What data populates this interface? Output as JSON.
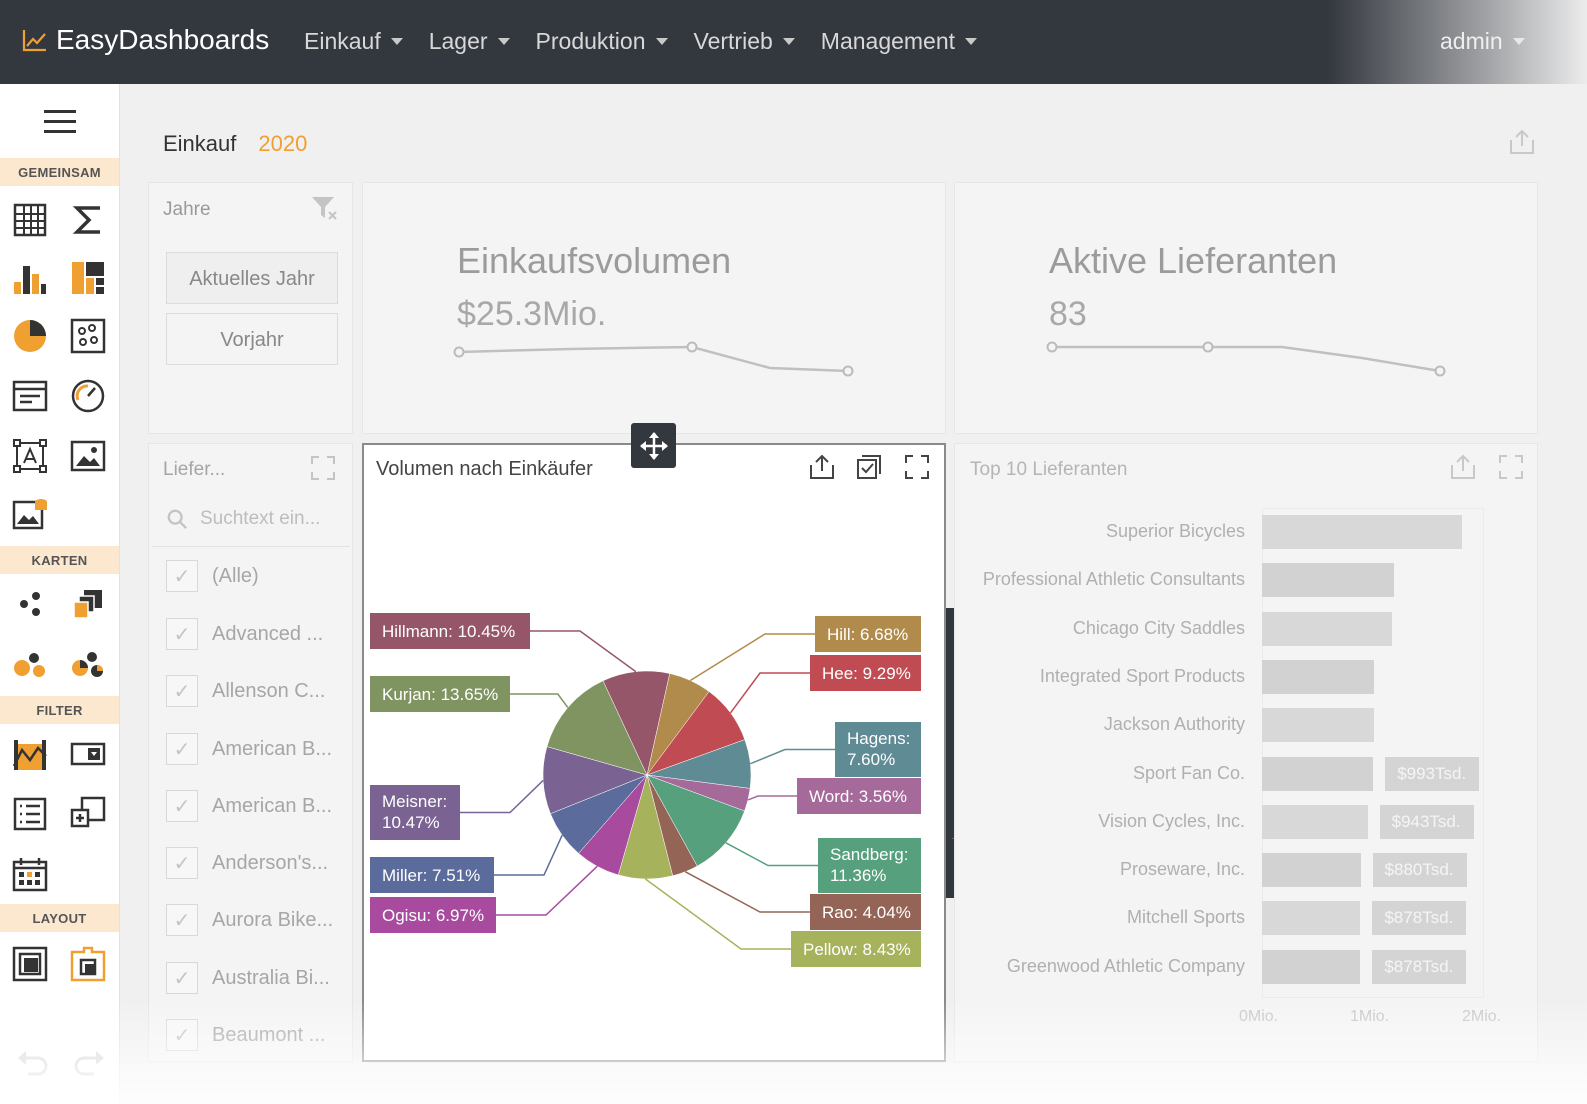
{
  "app": {
    "brand": "EasyDashboards",
    "user": "admin"
  },
  "nav": [
    "Einkauf",
    "Lager",
    "Produktion",
    "Vertrieb",
    "Management"
  ],
  "sidebar": {
    "sections": [
      "GEMEINSAM",
      "KARTEN",
      "FILTER",
      "LAYOUT"
    ],
    "icons": [
      "grid-icon",
      "sigma-icon",
      "bar-chart-icon",
      "treemap-icon",
      "pie-icon",
      "scatter-icon",
      "cards-icon",
      "gauge-icon",
      "text-box-icon",
      "image-icon",
      "bound-image-icon",
      "map-points-icon",
      "choropleth-icon",
      "bubble-map-icon",
      "pie-map-icon",
      "range-filter-icon",
      "combo-box-icon",
      "list-box-icon",
      "tree-view-icon",
      "date-filter-icon",
      "group-icon",
      "tab-container-icon"
    ]
  },
  "breadcrumb": {
    "page": "Einkauf",
    "year": "2020"
  },
  "years_filter": {
    "title": "Jahre",
    "options": [
      "Aktuelles Jahr",
      "Vorjahr"
    ]
  },
  "kpi": [
    {
      "title": "Einkaufsvolumen",
      "value": "$25.3Mio."
    },
    {
      "title": "Aktive Lieferanten",
      "value": "83"
    }
  ],
  "supplier_list": {
    "title": "Liefer...",
    "search_placeholder": "Suchtext ein...",
    "items": [
      "(Alle)",
      "Advanced ...",
      "Allenson C...",
      "American B...",
      "American B...",
      "Anderson's...",
      "Aurora Bike...",
      "Australia Bi...",
      "Beaumont ..."
    ]
  },
  "pie_panel": {
    "title": "Volumen nach Einkäufer"
  },
  "chart_data": [
    {
      "type": "pie",
      "title": "Volumen nach Einkäufer",
      "slices": [
        {
          "label": "Hill: 6.68%",
          "value": 6.68,
          "color": "#b08b4c"
        },
        {
          "label": "Hee: 9.29%",
          "value": 9.29,
          "color": "#c04b52"
        },
        {
          "label": "Hagens: 7.60%",
          "value": 7.6,
          "color": "#5f8b95"
        },
        {
          "label": "Word: 3.56%",
          "value": 3.56,
          "color": "#a56a99"
        },
        {
          "label": "Sandberg: 11.36%",
          "value": 11.36,
          "color": "#56a07d"
        },
        {
          "label": "Rao: 4.04%",
          "value": 4.04,
          "color": "#946557"
        },
        {
          "label": "Pellow: 8.43%",
          "value": 8.43,
          "color": "#a7b25c"
        },
        {
          "label": "Ogisu: 6.97%",
          "value": 6.97,
          "color": "#a84b9f"
        },
        {
          "label": "Miller: 7.51%",
          "value": 7.51,
          "color": "#5b6b9c"
        },
        {
          "label": "Meisner: 10.47%",
          "value": 10.47,
          "color": "#7a6392"
        },
        {
          "label": "Kurjan: 13.65%",
          "value": 13.65,
          "color": "#7f9461"
        },
        {
          "label": "Hillmann: 10.45%",
          "value": 10.45,
          "color": "#965669"
        }
      ]
    },
    {
      "type": "bar",
      "title": "Top 10 Lieferanten",
      "categories": [
        "Superior Bicycles",
        "Professional Athletic Consultants",
        "Chicago City Saddles",
        "Integrated Sport Products",
        "Jackson Authority",
        "Sport Fan Co.",
        "Vision Cycles, Inc.",
        "Proseware, Inc.",
        "Mitchell Sports",
        "Greenwood Athletic Company"
      ],
      "values": [
        1.79,
        1.18,
        1.16,
        1.0,
        1.0,
        0.993,
        0.943,
        0.88,
        0.878,
        0.878
      ],
      "value_labels": [
        "",
        "",
        "",
        "",
        "",
        "$993Tsd.",
        "$943Tsd.",
        "$880Tsd.",
        "$878Tsd.",
        "$878Tsd."
      ],
      "x_ticks": [
        "0Mio.",
        "1Mio.",
        "2Mio."
      ],
      "xlim": [
        0,
        2
      ]
    }
  ],
  "bars_panel": {
    "title": "Top 10 Lieferanten"
  }
}
